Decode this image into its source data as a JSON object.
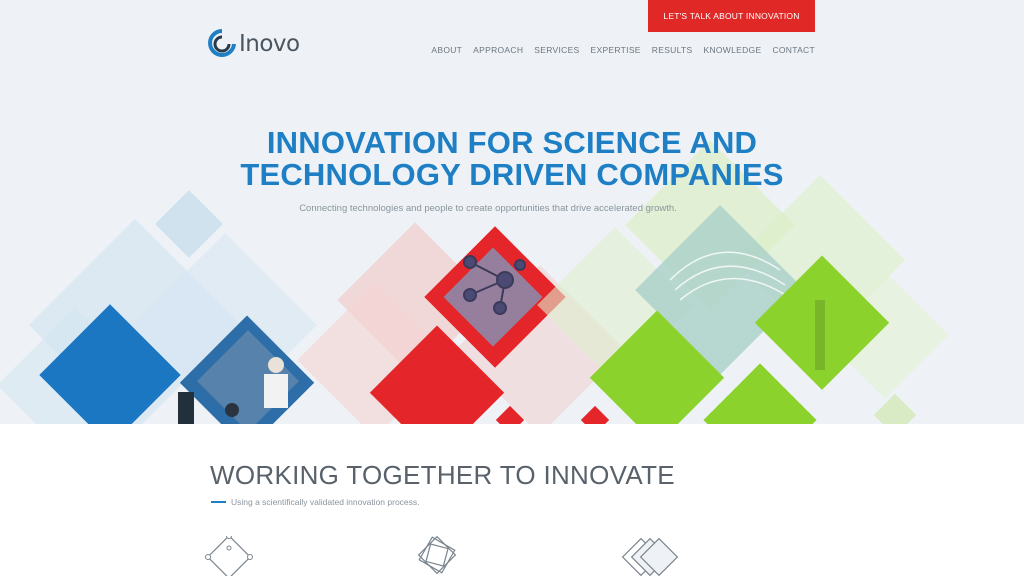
{
  "header": {
    "cta_label": "LET'S TALK ABOUT INNOVATION",
    "logo_text": "Inovo",
    "nav": [
      "ABOUT",
      "APPROACH",
      "SERVICES",
      "EXPERTISE",
      "RESULTS",
      "KNOWLEDGE",
      "CONTACT"
    ]
  },
  "hero": {
    "title_line1": "INNOVATION FOR SCIENCE AND",
    "title_line2": "TECHNOLOGY DRIVEN COMPANIES",
    "subtitle": "Connecting technologies and people to create opportunities that drive accelerated growth."
  },
  "section": {
    "title": "WORKING TOGETHER TO INNOVATE",
    "subtitle": "Using a scientifically validated innovation process."
  },
  "colors": {
    "accent_blue": "#1e7fc4",
    "cta_red": "#e02826",
    "diamond_red": "#e4262a",
    "diamond_green": "#8cd22d"
  },
  "icons": [
    "diamond-network-icon",
    "diamond-layers-icon",
    "diamond-stack-icon"
  ]
}
